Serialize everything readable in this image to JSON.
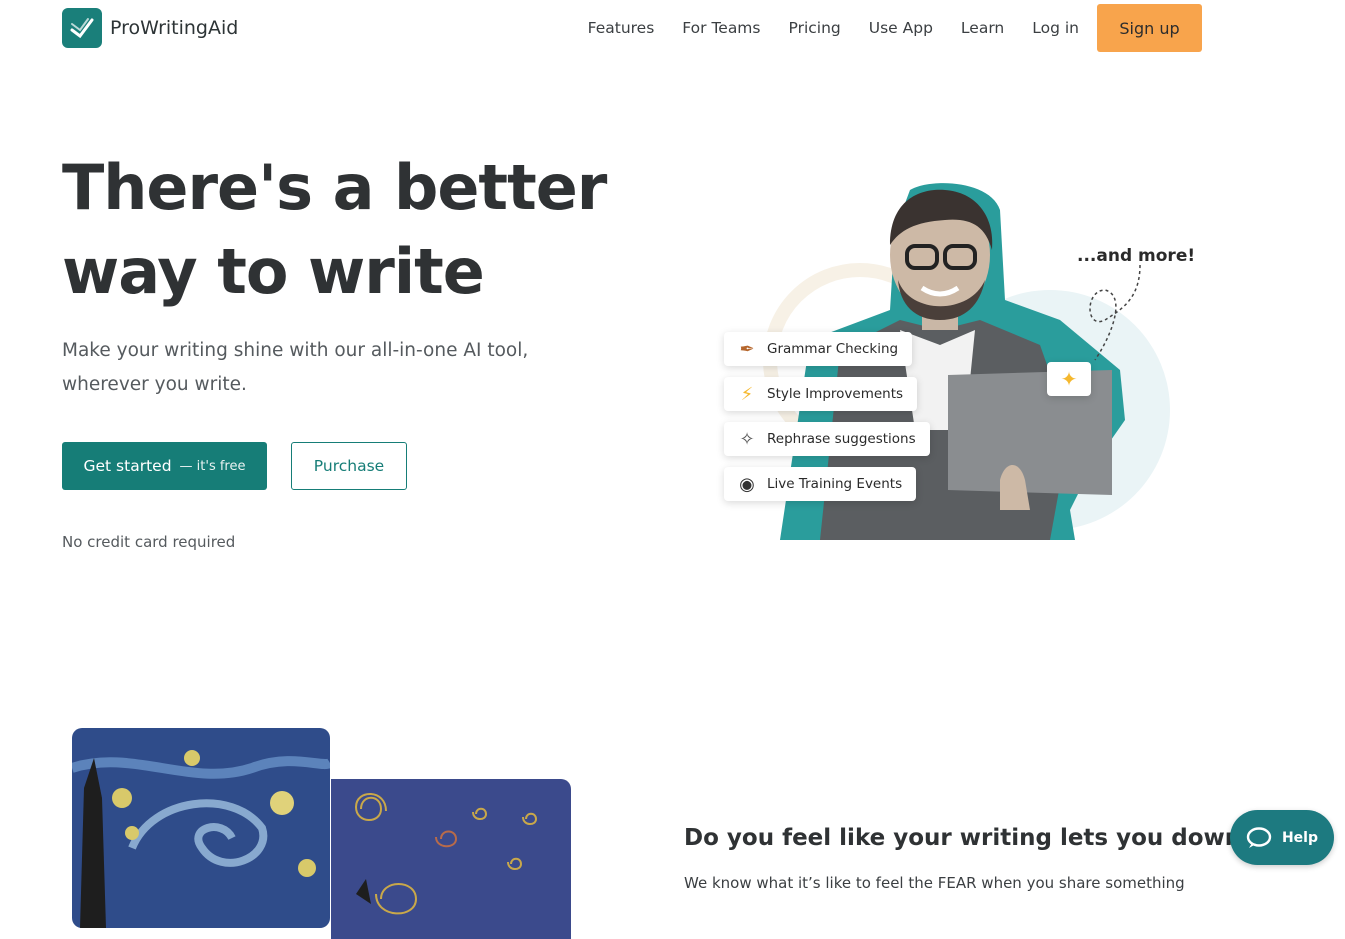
{
  "header": {
    "logo_text": "ProWritingAid",
    "nav": [
      "Features",
      "For Teams",
      "Pricing",
      "Use App",
      "Learn",
      "Log in"
    ],
    "signup_label": "Sign up"
  },
  "hero": {
    "title_line1": "There's a better",
    "title_line2": "way to write",
    "subtitle_line1": "Make your writing shine with our all-in-one AI tool,",
    "subtitle_line2": "wherever you write.",
    "cta_main": "Get started",
    "cta_sub": "— it's free",
    "purchase_label": "Purchase",
    "no_card": "No credit card required"
  },
  "illustration": {
    "chips": [
      {
        "label": "Grammar Checking",
        "icon": "feather-icon"
      },
      {
        "label": "Style Improvements",
        "icon": "lightning-icon"
      },
      {
        "label": "Rephrase suggestions",
        "icon": "magic-wand-icon"
      },
      {
        "label": "Live Training Events",
        "icon": "video-camera-icon"
      }
    ],
    "more_label": "...and more!"
  },
  "section": {
    "title": "Do you feel like your writing lets you down?",
    "text": "We know what it’s like to feel the FEAR when you share something"
  },
  "help": {
    "label": "Help"
  },
  "colors": {
    "brand": "#167d77",
    "accent": "#f8a44c",
    "help": "#1d7a80"
  }
}
